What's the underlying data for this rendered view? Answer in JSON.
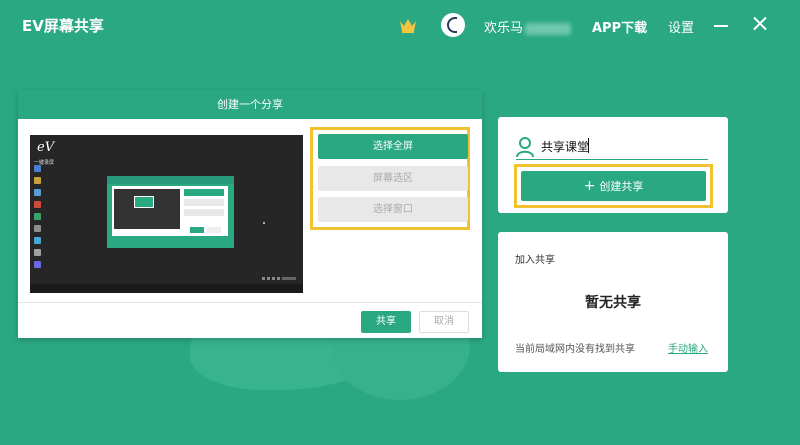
{
  "app": {
    "title": "EV屏幕共享",
    "username": "欢乐马",
    "app_download": "APP下载",
    "settings": "设置"
  },
  "dialog": {
    "title": "创建一个分享",
    "preview_logo": "eV",
    "preview_logo_sub": "一键录屏",
    "options": {
      "fullscreen": "选择全屏",
      "region": "屏幕选区",
      "window": "选择窗口"
    },
    "share_button": "共享",
    "cancel_button": "取消"
  },
  "create": {
    "name_value": "共享课堂",
    "create_button": "创建共享"
  },
  "join": {
    "title": "加入共享",
    "empty_title": "暂无共享",
    "empty_desc": "当前局域网内没有找到共享",
    "manual_link": "手动输入"
  },
  "colors": {
    "primary": "#2aa882",
    "highlight": "#f2c12e",
    "crown": "#f4c43f"
  }
}
